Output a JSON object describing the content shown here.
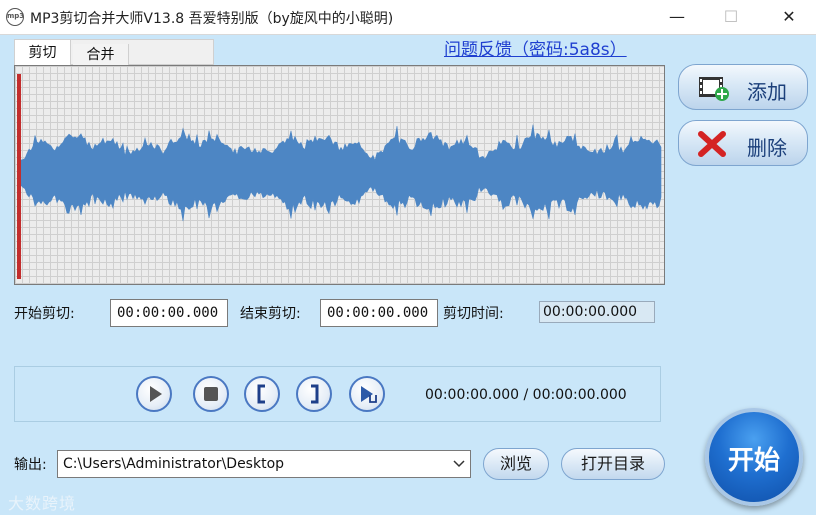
{
  "window": {
    "title": "MP3剪切合并大师V13.8 吾爱特别版（by旋风中的小聪明)",
    "app_icon_text": "mp3",
    "minimize": "—",
    "maximize": "☐",
    "close": "✕"
  },
  "tabs": [
    {
      "label": "剪切",
      "active": true
    },
    {
      "label": "合并",
      "active": false
    }
  ],
  "help_link": "问题反馈（密码:5a8s）",
  "cut": {
    "start_label": "开始剪切:",
    "start_value": "00:00:00.000",
    "end_label": "结束剪切:",
    "end_value": "00:00:00.000",
    "duration_label": "剪切时间:",
    "duration_value": "00:00:00.000"
  },
  "transport": {
    "buttons": [
      "play",
      "stop",
      "mark-start",
      "mark-end",
      "play-selection"
    ],
    "time_readout": "00:00:00.000 / 00:00:00.000"
  },
  "side_buttons": {
    "add_label": "添加",
    "delete_label": "删除"
  },
  "output": {
    "label": "输出:",
    "path": "C:\\Users\\Administrator\\Desktop"
  },
  "buttons": {
    "browse_label": "浏览",
    "open_dir_label": "打开目录",
    "start_label": "开始"
  },
  "icons": {
    "add": "film-add-icon",
    "delete": "red-x-icon",
    "dropdown": "chevron-down-icon"
  },
  "colors": {
    "background": "#c9e6f9",
    "waveform": "#4d86c4",
    "cursor": "#c22d2d",
    "link": "#1f3fd0",
    "start_button": "#1f6fd0"
  },
  "watermark": "大数跨境"
}
